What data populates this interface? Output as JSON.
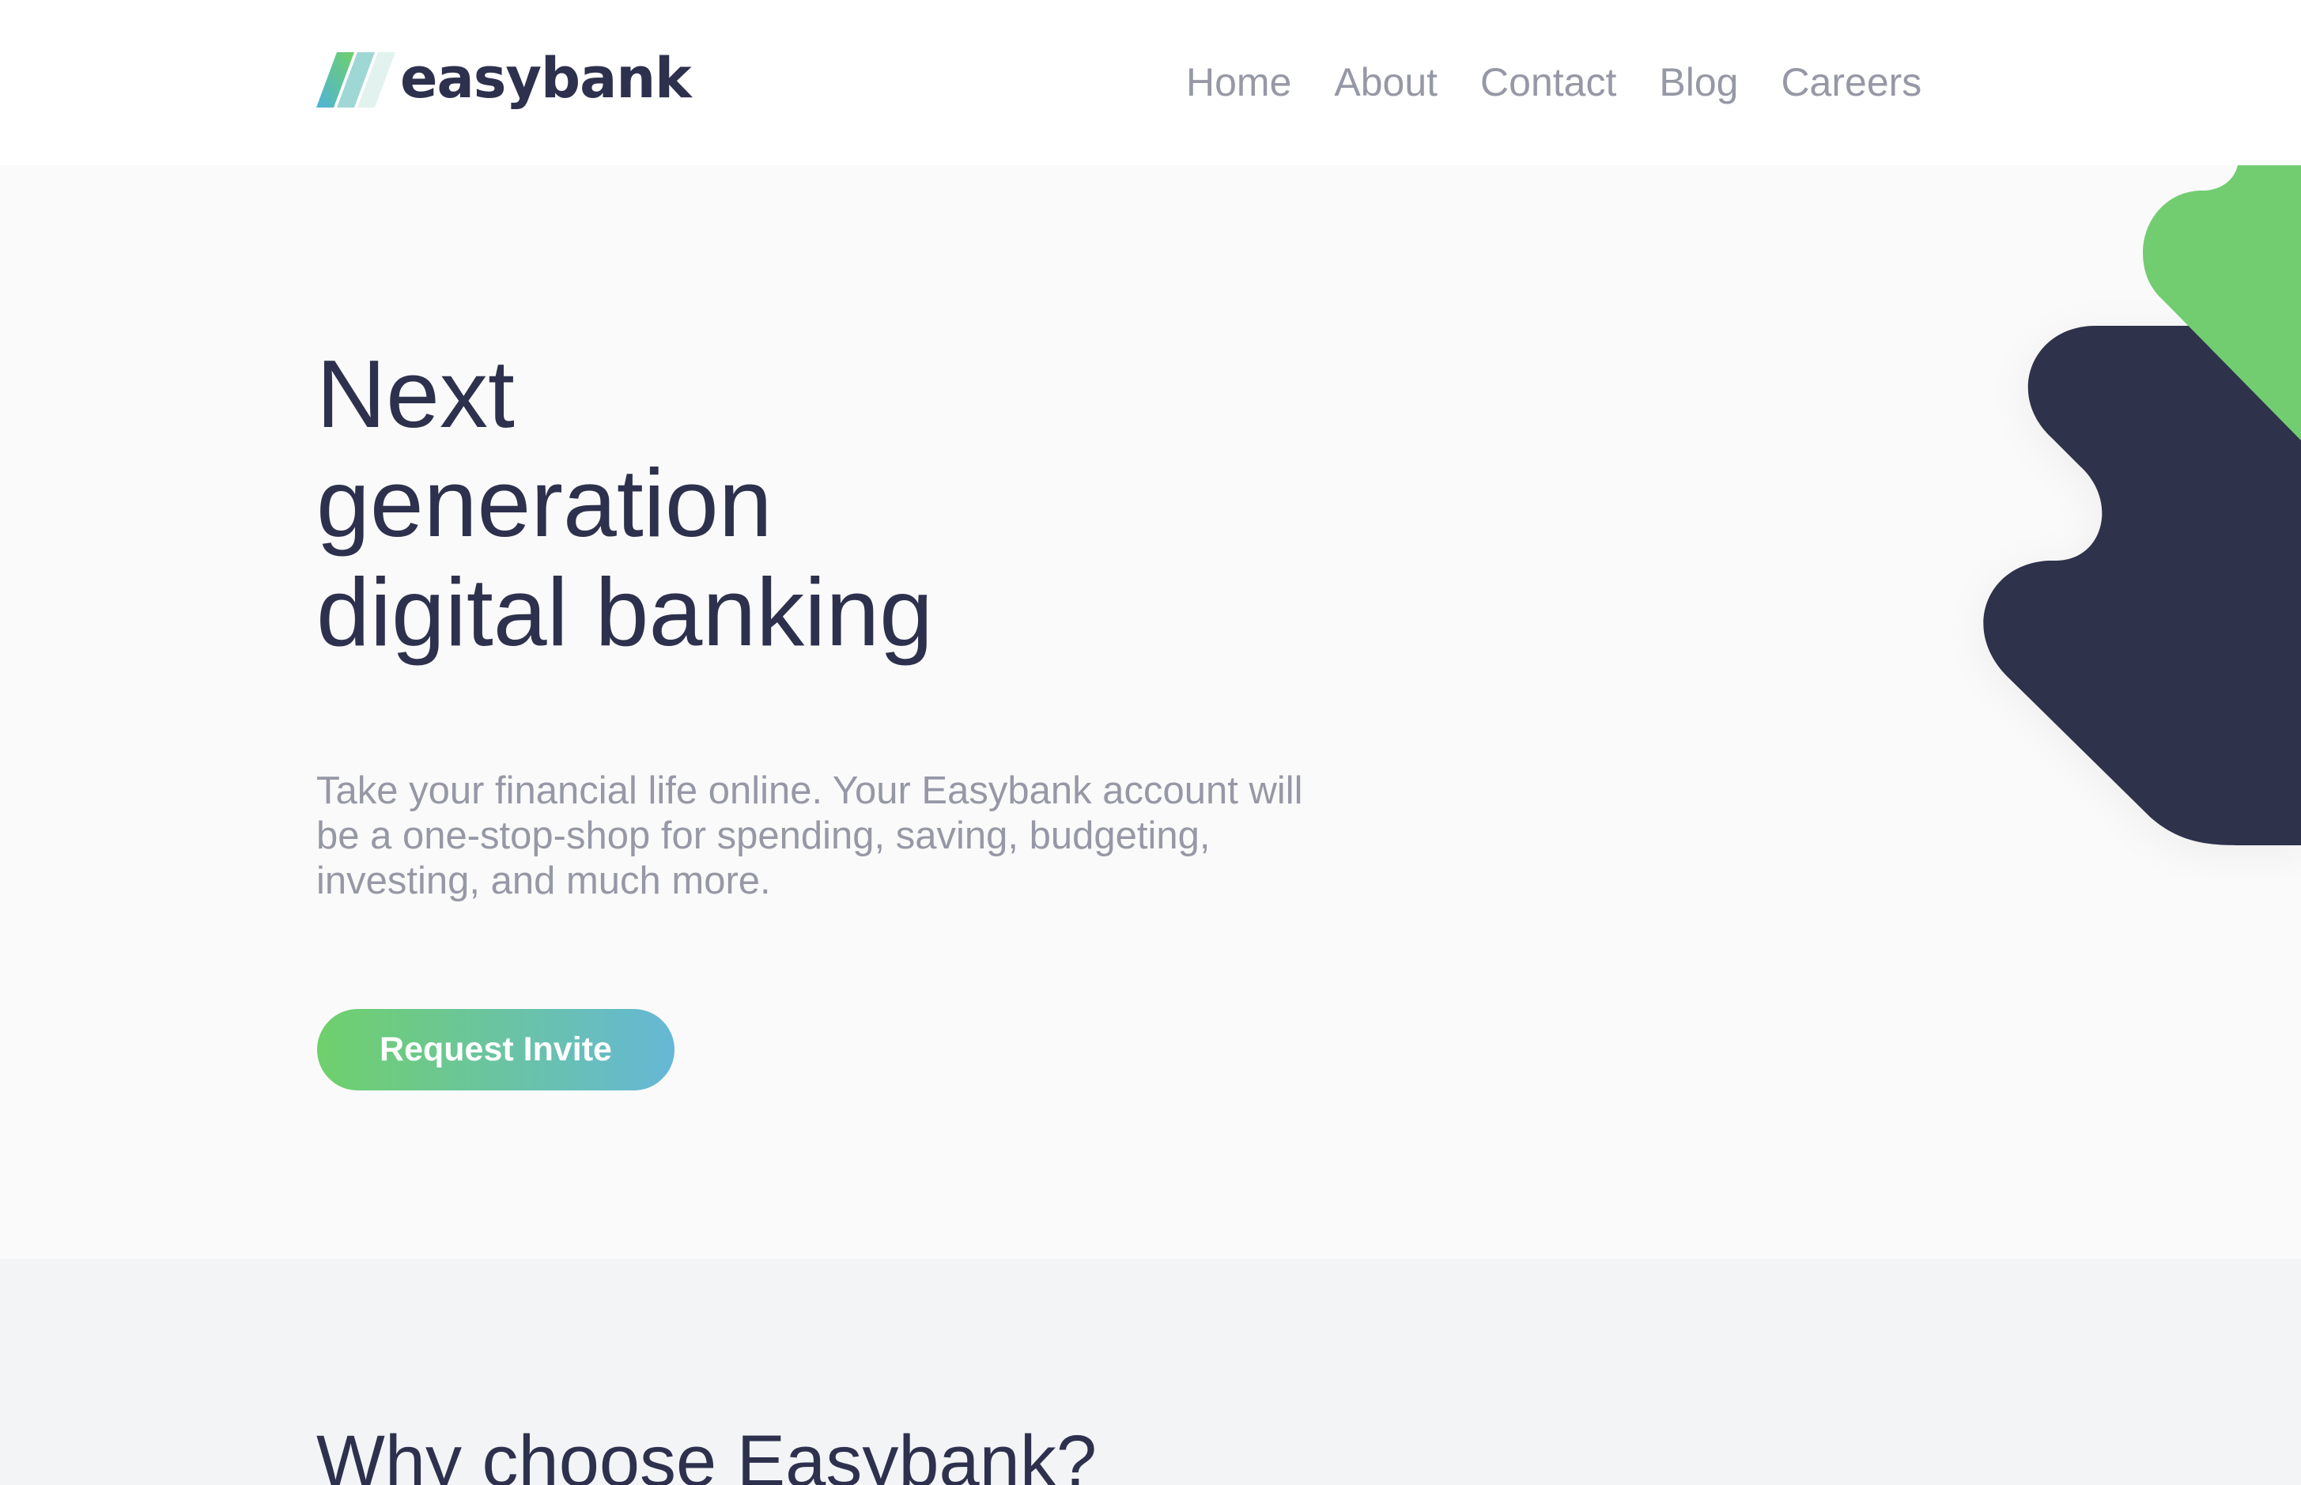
{
  "brand": {
    "name": "easybank",
    "colors": {
      "navy": "#2d314d",
      "green": "#31d35c",
      "cyan": "#2bb7da",
      "gray_text": "#9698a6"
    }
  },
  "nav": {
    "items": [
      {
        "label": "Home"
      },
      {
        "label": "About"
      },
      {
        "label": "Contact"
      },
      {
        "label": "Blog"
      },
      {
        "label": "Careers"
      }
    ]
  },
  "hero": {
    "title_lines": [
      "Next",
      "generation",
      "digital banking"
    ],
    "description": "Take your financial life online. Your Easybank account will be a one-stop-shop for spending, saving, budgeting, investing, and much more.",
    "cta_label": "Request Invite"
  },
  "features": {
    "heading": "Why choose Easybank?"
  }
}
